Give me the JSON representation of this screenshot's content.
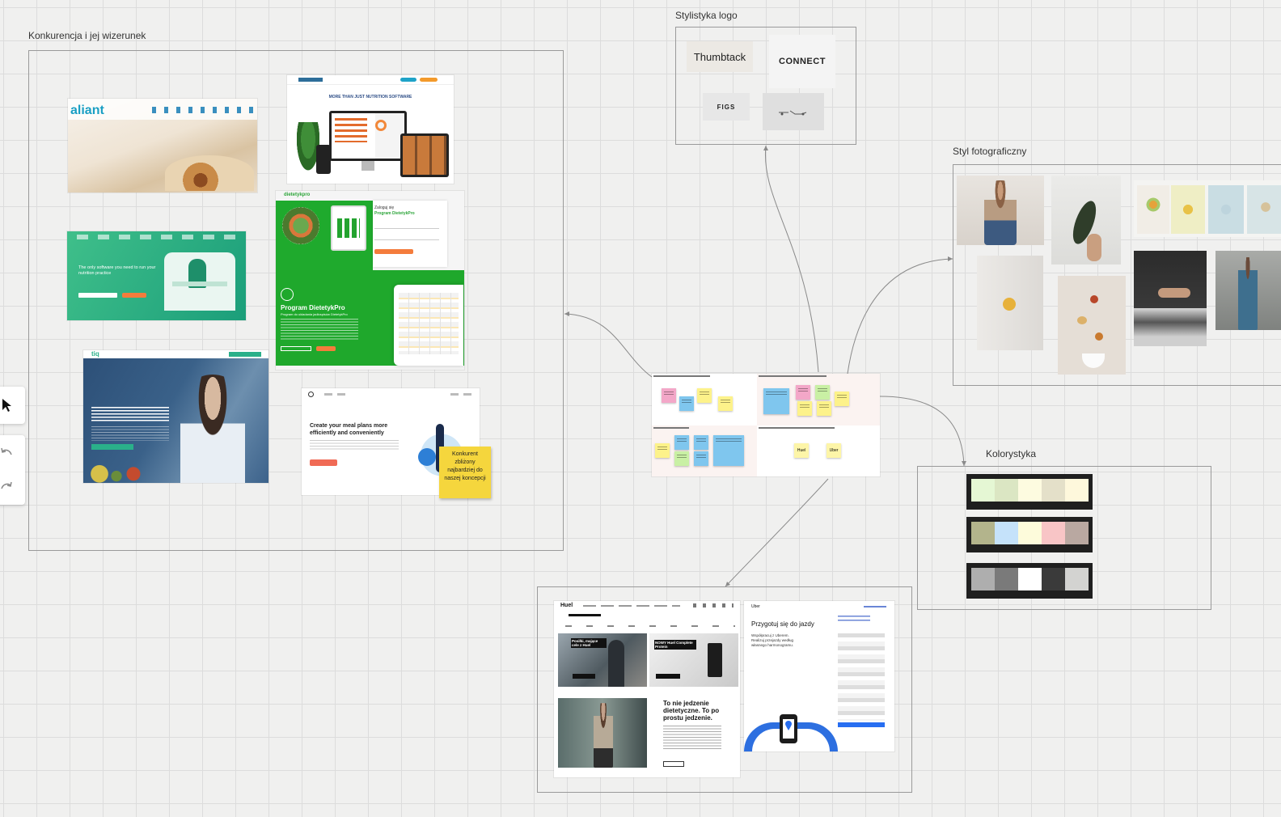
{
  "frames": {
    "competitors": {
      "label": "Konkurencja i jej wizerunek"
    },
    "logo_style": {
      "label": "Stylistyka logo"
    },
    "photo_style": {
      "label": "Styl fotograficzny"
    },
    "colors": {
      "label": "Kolorystyka"
    }
  },
  "competitors": {
    "aliant": {
      "logo": "aliant"
    },
    "nutritio": {
      "headline": "MORE THAN JUST NUTRITION SOFTWARE"
    },
    "dietetyk": {
      "brand": "dietetykpro",
      "login_title": "Zaloguj się",
      "login_subtitle": "Program DietetykPro",
      "banner_title": "Program DietetykPro",
      "banner_subtitle": "Program do układania jadłospisów DietetykPro"
    },
    "green_site": {
      "headline": "The only software you need to run your nutrition practice"
    },
    "tiq": {
      "logo": "tiq"
    },
    "mealplan": {
      "headline": "Create your meal plans more efficiently and conveniently"
    },
    "sticky_note": "Konkurent zbliżony najbardziej do naszej koncepcji"
  },
  "logos": {
    "thumbtack": "Thumbtack",
    "connect": "CONNECT",
    "figs": "FIGS",
    "scooter": "scooter"
  },
  "board": {
    "stickies": {
      "huel": "Huel",
      "uber": "Uber"
    }
  },
  "bottom_sites": {
    "huel": {
      "logo": "Huel",
      "card1": "Posiłki, mające cele z Huel",
      "card2": "NOWY Huel Complete Protein",
      "headline": "To nie jedzenie dietetyczne. To po prostu jedzenie."
    },
    "uber": {
      "logo": "Uber",
      "headline": "Przygotuj się do jazdy",
      "subtext": "Współpracuj z Uberem. Realizuj przejazdy według własnego harmonogramu."
    }
  },
  "palettes": [
    [
      "#e5f7d4",
      "#dbe6c3",
      "#fdfbe0",
      "#e4e0c9",
      "#fef8dc"
    ],
    [
      "#b3b48c",
      "#c5e2fa",
      "#fdfbdb",
      "#f8c5c6",
      "#b9a8a1"
    ],
    [
      "#aeaeae",
      "#7a7a7a",
      "#ffffff",
      "#3a3a3a",
      "#d3d3d1"
    ]
  ],
  "toolbar": {
    "tools": [
      "select",
      "undo",
      "redo"
    ]
  }
}
